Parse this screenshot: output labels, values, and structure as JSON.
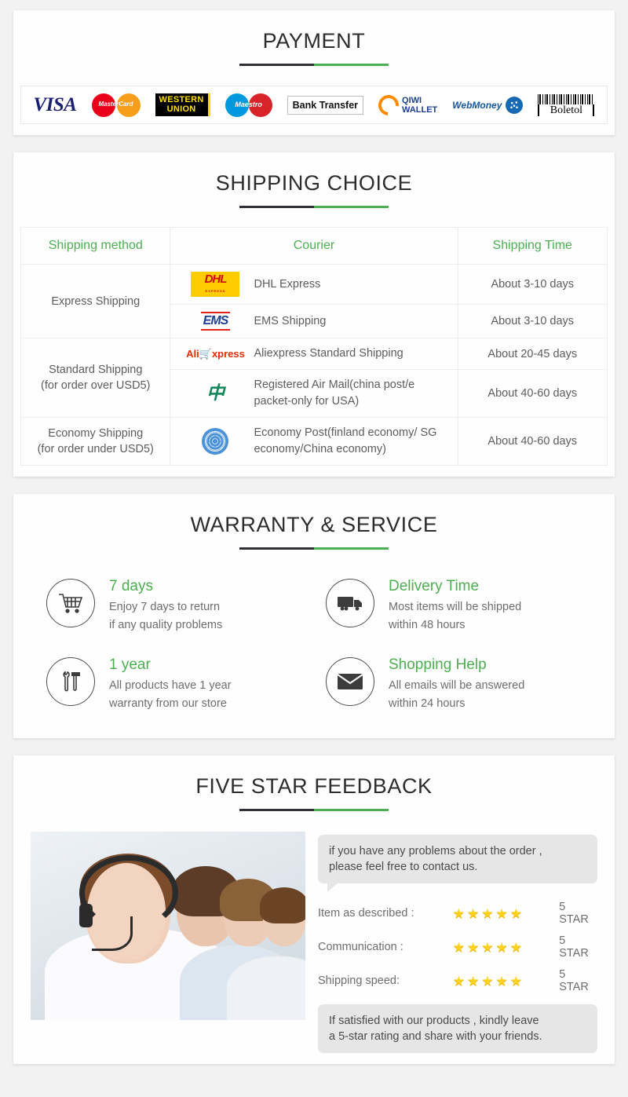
{
  "sections": {
    "payment": {
      "title": "PAYMENT",
      "methods": [
        {
          "name": "visa-logo",
          "label": "VISA"
        },
        {
          "name": "mastercard-logo",
          "label": "MasterCard"
        },
        {
          "name": "western-union-logo",
          "label_line1": "WESTERN",
          "label_line2": "UNION"
        },
        {
          "name": "maestro-logo",
          "label": "Maestro"
        },
        {
          "name": "bank-transfer-logo",
          "label": "Bank Transfer"
        },
        {
          "name": "qiwi-wallet-logo",
          "label_line1": "QIWI",
          "label_line2": "WALLET"
        },
        {
          "name": "webmoney-logo",
          "label": "WebMoney"
        },
        {
          "name": "boleto-logo",
          "label": "Boletol"
        }
      ]
    },
    "shipping": {
      "title": "SHIPPING CHOICE",
      "columns": [
        "Shipping method",
        "Courier",
        "Shipping Time"
      ],
      "rows": [
        {
          "method": "Express Shipping",
          "method_rowspan": 2,
          "courier_logo": "dhl-logo",
          "courier_logo_text": "DHL",
          "courier_logo_sub": "EXPRESS",
          "courier": "DHL Express",
          "time": "About 3-10 days"
        },
        {
          "method": "",
          "method_rowspan": 0,
          "courier_logo": "ems-logo",
          "courier_logo_text": "EMS",
          "courier": "EMS Shipping",
          "time": "About 3-10 days"
        },
        {
          "method": "Standard Shipping",
          "method_line2": "(for order over USD5)",
          "method_rowspan": 2,
          "courier_logo": "aliexpress-logo",
          "courier_logo_text": "Ali",
          "courier_logo_text2": "xpress",
          "courier": "Aliexpress Standard Shipping",
          "time": "About 20-45 days"
        },
        {
          "method": "",
          "method_rowspan": 0,
          "courier_logo": "china-post-logo",
          "courier_logo_text": "中",
          "courier": "Registered Air Mail(china post/e packet-only for USA)",
          "time": "About 40-60 days"
        },
        {
          "method": "Economy Shipping",
          "method_line2": "(for order under USD5)",
          "method_rowspan": 1,
          "courier_logo": "un-post-logo",
          "courier": "Economy Post(finland economy/ SG economy/China economy)",
          "time": "About 40-60 days"
        }
      ]
    },
    "warranty": {
      "title": "WARRANTY & SERVICE",
      "items": [
        {
          "icon": "shopping-cart-icon",
          "heading": "7 days",
          "line1": "Enjoy 7 days to return",
          "line2": "if any quality problems"
        },
        {
          "icon": "truck-icon",
          "heading": "Delivery Time",
          "line1": "Most items will be shipped",
          "line2": "within 48 hours"
        },
        {
          "icon": "tools-icon",
          "heading": "1 year",
          "line1": "All products have 1 year",
          "line2": "warranty from our store"
        },
        {
          "icon": "envelope-icon",
          "heading": "Shopping Help",
          "line1": "All emails will be answered",
          "line2": "within 24 hours"
        }
      ]
    },
    "feedback": {
      "title": "FIVE STAR FEEDBACK",
      "photo_alt": "customer-service-team-photo",
      "bubble_top_line1": "if you have any problems about the order ,",
      "bubble_top_line2": "please feel free to contact us.",
      "ratings": [
        {
          "label": "Item as described :",
          "stars": 5,
          "value": "5 STAR"
        },
        {
          "label": "Communication :",
          "stars": 5,
          "value": "5 STAR"
        },
        {
          "label": "Shipping speed:",
          "stars": 5,
          "value": "5 STAR"
        }
      ],
      "bubble_bottom_line1": "If satisfied with our products ,  kindly leave",
      "bubble_bottom_line2": "a 5-star rating and share with your friends."
    }
  },
  "colors": {
    "accent_green": "#4caf50",
    "heading_dark": "#2c2c2c",
    "body_text": "#6d6d6d",
    "star": "#ffd21e",
    "page_bg": "#f2f2f2"
  },
  "star_glyph": "★"
}
